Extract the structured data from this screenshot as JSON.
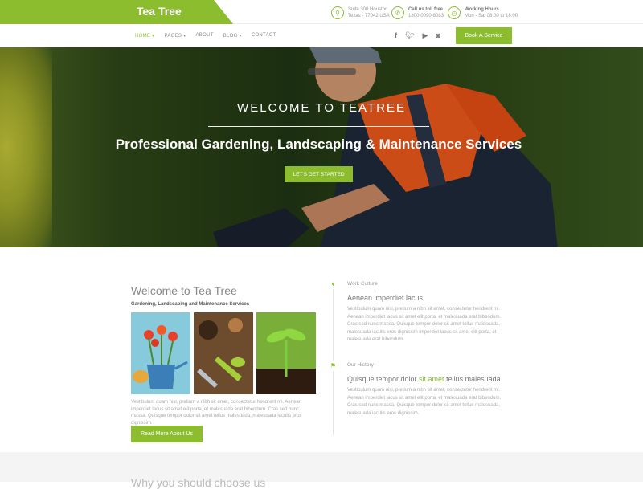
{
  "brand": {
    "name": "Tea Tree"
  },
  "contact": [
    {
      "icon": "location-pin-icon",
      "line1": "Suite 300 Houston",
      "line2": "Texas - 77042 USA"
    },
    {
      "icon": "phone-icon",
      "line1": "Call us toll free",
      "line2": "1800-0090-8083"
    },
    {
      "icon": "clock-icon",
      "line1": "Working Hours",
      "line2": "Mon - Sat 08:00 to 18:00"
    }
  ],
  "nav": {
    "items": [
      "HOME ▾",
      "PAGES ▾",
      "ABOUT",
      "BLOG ▾",
      "CONTACT"
    ],
    "book_label": "Book A Service"
  },
  "social": [
    "facebook-icon",
    "twitter-icon",
    "youtube-icon",
    "instagram-icon"
  ],
  "hero": {
    "subtitle": "WELCOME TO TEATREE",
    "title": "Professional Gardening, Landscaping & Maintenance Services",
    "cta": "LET'S GET STARTED"
  },
  "about": {
    "title": "Welcome to Tea Tree",
    "subtitle": "Gardening, Landscaping and Maintenance Services",
    "body": "Vestibulum quam nisi, pretium a nibh sit amet, consectetur hendrerit mi. Aenean imperdiet lacus sit amet elit porta, et malesuada erat bibendum. Cras sed nunc massa. Quisque tempor dolor sit amet tellus malesuada, malesuada iaculis eros dignissim.",
    "button": "Read More About Us"
  },
  "timeline": [
    {
      "label": "Work Culture",
      "heading": "Aenean imperdiet lacus",
      "text": "Vestibulum quam nisi, pretium a nibh sit amet, consectetur hendrerit mi. Aenean imperdiet lacus sit amet elit porta, et malesuada erat bibendum. Cras sed nunc massa. Quisque tempor dolor sit amet tellus malesuada, malesuada iaculis eros dignissim imperdiet lacus sit amet elit porta, et malesuada erat bibendum."
    },
    {
      "label": "Our History",
      "heading_pre": "Quisque tempor dolor ",
      "heading_hl": "sit amet",
      "heading_post": " tellus malesuada",
      "text": "Vestibulum quam nisi, pretium a nibh sit amet, consectetur hendrerit mi. Aenean imperdiet lacus sit amet elit porta, et malesuada erat bibendum. Cras sed nunc massa. Quisque tempor dolor sit amet tellus malesuada, malesuada iaculis eros dignissim."
    }
  ],
  "next_section": {
    "title": "Why you should choose us"
  },
  "colors": {
    "accent": "#8bbd2f"
  }
}
